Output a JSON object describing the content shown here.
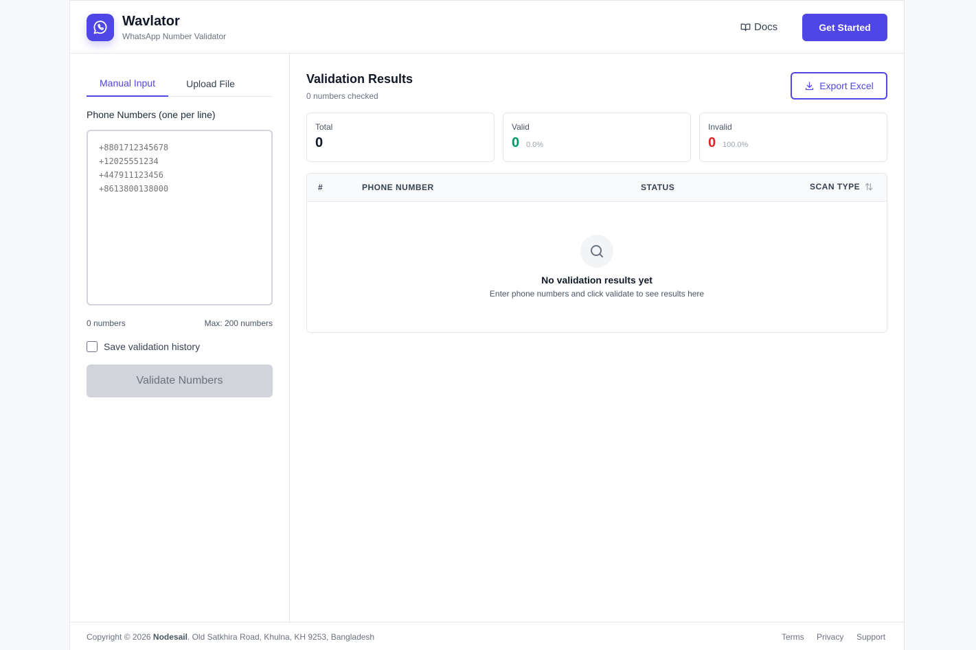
{
  "header": {
    "app_name": "Wavlator",
    "app_subtitle": "WhatsApp Number Validator",
    "docs_label": "Docs",
    "get_started_label": "Get Started"
  },
  "input_panel": {
    "tabs": [
      {
        "label": "Manual Input",
        "active": true
      },
      {
        "label": "Upload File",
        "active": false
      }
    ],
    "phone_label": "Phone Numbers (one per line)",
    "textarea_value": "",
    "textarea_placeholder": "+8801712345678\n+12025551234\n+447911123456\n+8613800138000",
    "count_label": "0 numbers",
    "max_label": "Max: 200 numbers",
    "save_history_label": "Save validation history",
    "save_history_checked": false,
    "validate_label": "Validate Numbers"
  },
  "results": {
    "title": "Validation Results",
    "subtitle": "0 numbers checked",
    "export_label": "Export Excel",
    "stats": [
      {
        "label": "Total",
        "value": "0",
        "percent": "",
        "color": "#111827"
      },
      {
        "label": "Valid",
        "value": "0",
        "percent": "0.0%",
        "color": "#059669"
      },
      {
        "label": "Invalid",
        "value": "0",
        "percent": "100.0%",
        "color": "#dc2626"
      }
    ],
    "columns": [
      "#",
      "PHONE NUMBER",
      "STATUS",
      "SCAN TYPE"
    ],
    "empty_title": "No validation results yet",
    "empty_subtitle": "Enter phone numbers and click validate to see results here"
  },
  "footer": {
    "copyright_prefix": "Copyright © 2026",
    "company": "Nodesail",
    "address": ". Old Satkhira Road, Khulna, KH 9253, Bangladesh",
    "links": [
      "Terms",
      "Privacy",
      "Support"
    ]
  },
  "colors": {
    "accent": "#4f46e5",
    "valid": "#059669",
    "invalid": "#dc2626"
  }
}
